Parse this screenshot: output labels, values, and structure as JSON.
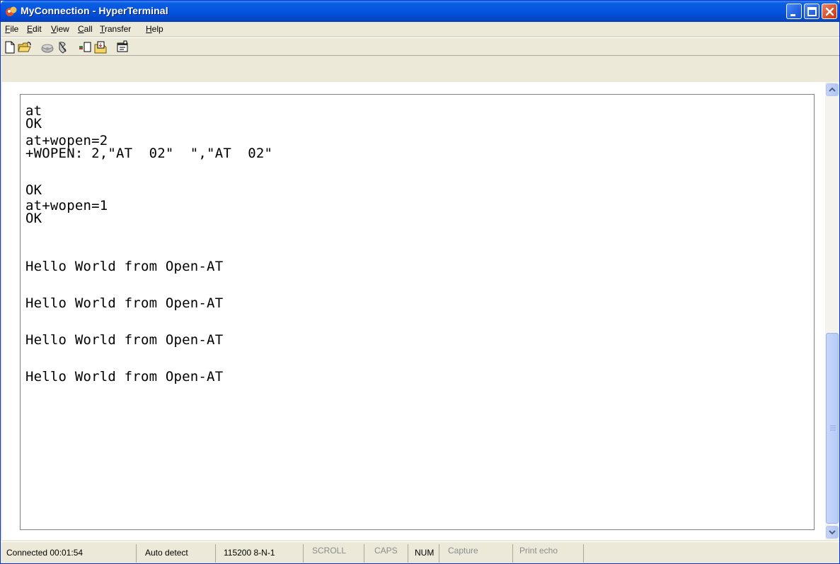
{
  "window": {
    "title": "MyConnection - HyperTerminal"
  },
  "menu": [
    {
      "mnemonic": "F",
      "rest": "ile"
    },
    {
      "mnemonic": "E",
      "rest": "dit"
    },
    {
      "mnemonic": "V",
      "rest": "iew"
    },
    {
      "mnemonic": "C",
      "rest": "all"
    },
    {
      "mnemonic": "T",
      "rest": "ransfer"
    },
    {
      "mnemonic": "H",
      "rest": "elp"
    }
  ],
  "terminal": {
    "lines": [
      "at",
      "OK",
      "at+wopen=2",
      "+WOPEN: 2,\"AT  02\"  \",\"AT  02\"",
      "OK",
      "at+wopen=1",
      "OK",
      "Hello World from Open-AT",
      "Hello World from Open-AT",
      "Hello World from Open-AT",
      "Hello World from Open-AT"
    ]
  },
  "status": {
    "connected": "Connected 00:01:54",
    "detect": "Auto detect",
    "settings": "115200 8-N-1",
    "scroll": "SCROLL",
    "caps": "CAPS",
    "num": "NUM",
    "capture": "Capture",
    "print_echo": "Print echo"
  },
  "colors": {
    "title_bar": "#0654e0",
    "close_button": "#d9532e",
    "chrome": "#ece9d8"
  },
  "icons": [
    "app-icon",
    "minimize-icon",
    "maximize-icon",
    "close-icon",
    "new-icon",
    "open-icon",
    "connect-icon",
    "disconnect-icon",
    "send-icon",
    "receive-icon",
    "properties-icon"
  ]
}
